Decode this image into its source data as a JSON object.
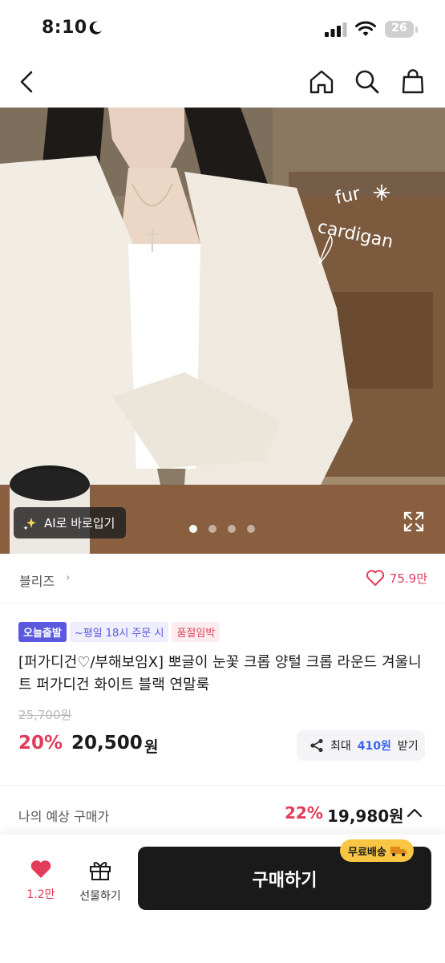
{
  "status_bar": {
    "time": "8:10",
    "battery": "26"
  },
  "nav": {
    "icons": [
      "back-icon",
      "home-icon",
      "search-icon",
      "bag-icon"
    ]
  },
  "hero": {
    "overlay_text": [
      "fur",
      "cardigan"
    ],
    "ai_button_label": "AI로 바로입기",
    "dots_total": 4,
    "dots_active": 1
  },
  "brand": {
    "name": "블리즈",
    "likes": "75.9만"
  },
  "badges": {
    "today": "오늘출발",
    "deadline": "~평일 18시 주문 시",
    "sold_out": "품절임박"
  },
  "product": {
    "title": "[퍼가디건♡/부해보임X] 뽀글이 눈꽃 크롭 양털 크롭 라운드 겨울니트 퍼가디건 화이트 블랙 연말룩",
    "original_price": "25,700원",
    "discount": "20%",
    "price": "20,500",
    "currency": "원"
  },
  "points": {
    "prefix": "최대",
    "amount": "410원",
    "suffix": "받기"
  },
  "expected": {
    "label": "나의 예상 구매가",
    "discount": "22%",
    "price": "19,980원"
  },
  "bottom_bar": {
    "like_count": "1.2만",
    "gift_label": "선물하기",
    "buy_label": "구매하기",
    "shipping_badge": "무료배송"
  },
  "colors": {
    "accent": "#e33c5a",
    "brand": "#5b58e0",
    "point_blue": "#3d63f5",
    "ship_yellow": "#f8c544"
  }
}
